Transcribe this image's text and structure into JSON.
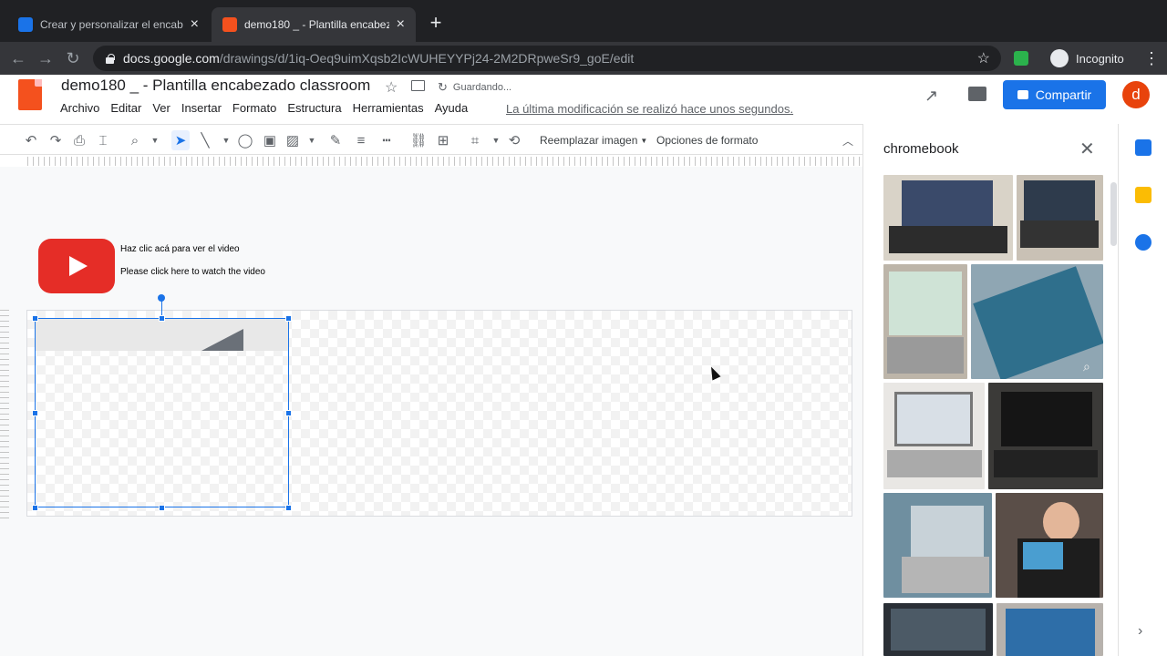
{
  "browser": {
    "tabs": [
      {
        "title": "Crear y personalizar el encabe",
        "active": false
      },
      {
        "title": "demo180 _ - Plantilla encabeza",
        "active": true
      }
    ],
    "new_tab": "+",
    "url_host": "docs.google.com",
    "url_path": "/drawings/d/1iq-Oeq9uimXqsb2IcWUHEYYPj24-2M2DRpweSr9_goE/edit",
    "profile_label": "Incognito"
  },
  "app": {
    "doc_title": "demo180 _ - Plantilla encabezado classroom",
    "save_status": "Guardando...",
    "menu": [
      "Archivo",
      "Editar",
      "Ver",
      "Insertar",
      "Formato",
      "Estructura",
      "Herramientas",
      "Ayuda"
    ],
    "last_modified": "La última modificación se realizó hace unos segundos.",
    "share_label": "Compartir",
    "avatar_letter": "d"
  },
  "toolbar": {
    "replace_image": "Reemplazar imagen",
    "format_options": "Opciones de formato"
  },
  "canvas": {
    "caption_es": "Haz clic acá para ver el video",
    "caption_en": "Please click here to watch the video"
  },
  "side_panel": {
    "search_query": "chromebook"
  },
  "colors": {
    "accent": "#1a73e8",
    "youtube_red": "#e52d27",
    "drawings_orange": "#f4511e"
  }
}
